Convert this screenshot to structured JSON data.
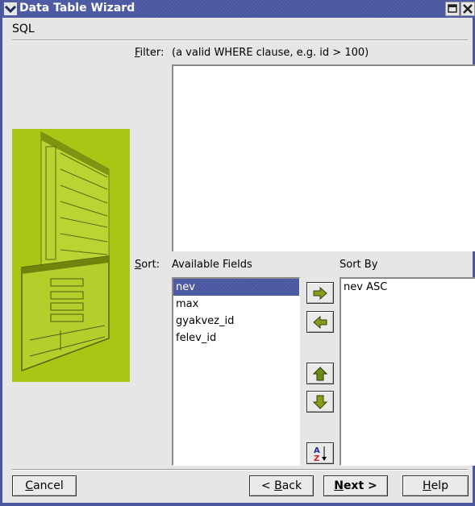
{
  "window": {
    "title": "Data Table Wizard",
    "menu_icon": "chevron-down-icon",
    "maximize_icon": "maximize-icon",
    "close_icon": "close-icon"
  },
  "page": {
    "section_title": "SQL"
  },
  "filter": {
    "label_mnemonic": "F",
    "label_rest": "ilter:",
    "hint": "(a valid WHERE clause, e.g. id > 100)",
    "value": ""
  },
  "sort": {
    "label_mnemonic": "S",
    "label_rest": "ort:",
    "available_header": "Available Fields",
    "sort_by_header": "Sort By",
    "available_fields": [
      {
        "label": "nev",
        "selected": true
      },
      {
        "label": "max",
        "selected": false
      },
      {
        "label": "gyakvez_id",
        "selected": false
      },
      {
        "label": "felev_id",
        "selected": false
      }
    ],
    "sort_by_items": [
      {
        "label": "nev ASC"
      }
    ],
    "buttons": {
      "add": "arrow-right-icon",
      "remove": "arrow-left-icon",
      "move_up": "arrow-up-icon",
      "move_down": "arrow-down-icon",
      "toggle_order": "sort-az-icon"
    }
  },
  "footer": {
    "cancel": {
      "mnemonic": "C",
      "rest": "ancel"
    },
    "back": {
      "prefix": "< ",
      "mnemonic": "B",
      "rest": "ack"
    },
    "next": {
      "mnemonic": "N",
      "rest": "ext >"
    },
    "help": {
      "mnemonic": "H",
      "rest": "elp"
    }
  },
  "colors": {
    "titlebar": "#4a579f",
    "selection": "#4a579f",
    "graphic": "#a7c714",
    "arrow_fill": "#8a9a1a"
  }
}
